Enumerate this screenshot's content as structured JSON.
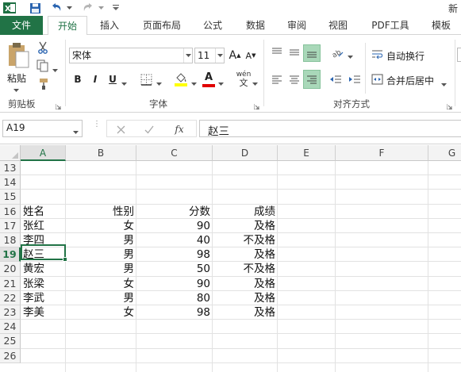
{
  "title_bar": {
    "title_fragment": "新"
  },
  "tabs": [
    {
      "label": "文件"
    },
    {
      "label": "开始"
    },
    {
      "label": "插入"
    },
    {
      "label": "页面布局"
    },
    {
      "label": "公式"
    },
    {
      "label": "数据"
    },
    {
      "label": "审阅"
    },
    {
      "label": "视图"
    },
    {
      "label": "PDF工具"
    },
    {
      "label": "模板"
    }
  ],
  "ribbon": {
    "clipboard": {
      "paste_label": "粘贴",
      "group_label": "剪贴板"
    },
    "font": {
      "font_name": "宋体",
      "font_size": "11",
      "bold": "B",
      "italic": "I",
      "underline": "U",
      "grow_font": "A",
      "shrink_font": "A",
      "font_color_glyph": "A",
      "phonetic_glyph": "wén",
      "phonetic_sub": "文",
      "group_label": "字体",
      "highlight_color": "#ffff00",
      "font_color": "#e00000"
    },
    "alignment": {
      "wrap_text": "自动换行",
      "merge_center": "合并后居中",
      "group_label": "对齐方式"
    }
  },
  "formula_bar": {
    "name_box": "A19",
    "fx": "fx",
    "formula": "赵三"
  },
  "columns": [
    "A",
    "B",
    "C",
    "D",
    "E",
    "F",
    "G"
  ],
  "rows": [
    "13",
    "14",
    "15",
    "16",
    "17",
    "18",
    "19",
    "20",
    "21",
    "22",
    "23",
    "24",
    "25",
    "26"
  ],
  "table": {
    "headers": [
      "姓名",
      "性别",
      "分数",
      "成绩"
    ],
    "records": [
      [
        "张红",
        "女",
        "90",
        "及格"
      ],
      [
        "李四",
        "男",
        "40",
        "不及格"
      ],
      [
        "赵三",
        "男",
        "98",
        "及格"
      ],
      [
        "黄宏",
        "男",
        "50",
        "不及格"
      ],
      [
        "张梁",
        "女",
        "90",
        "及格"
      ],
      [
        "李武",
        "男",
        "80",
        "及格"
      ],
      [
        "李美",
        "女",
        "98",
        "及格"
      ]
    ]
  },
  "selection": {
    "cell": "A19",
    "accent": "#217346"
  }
}
